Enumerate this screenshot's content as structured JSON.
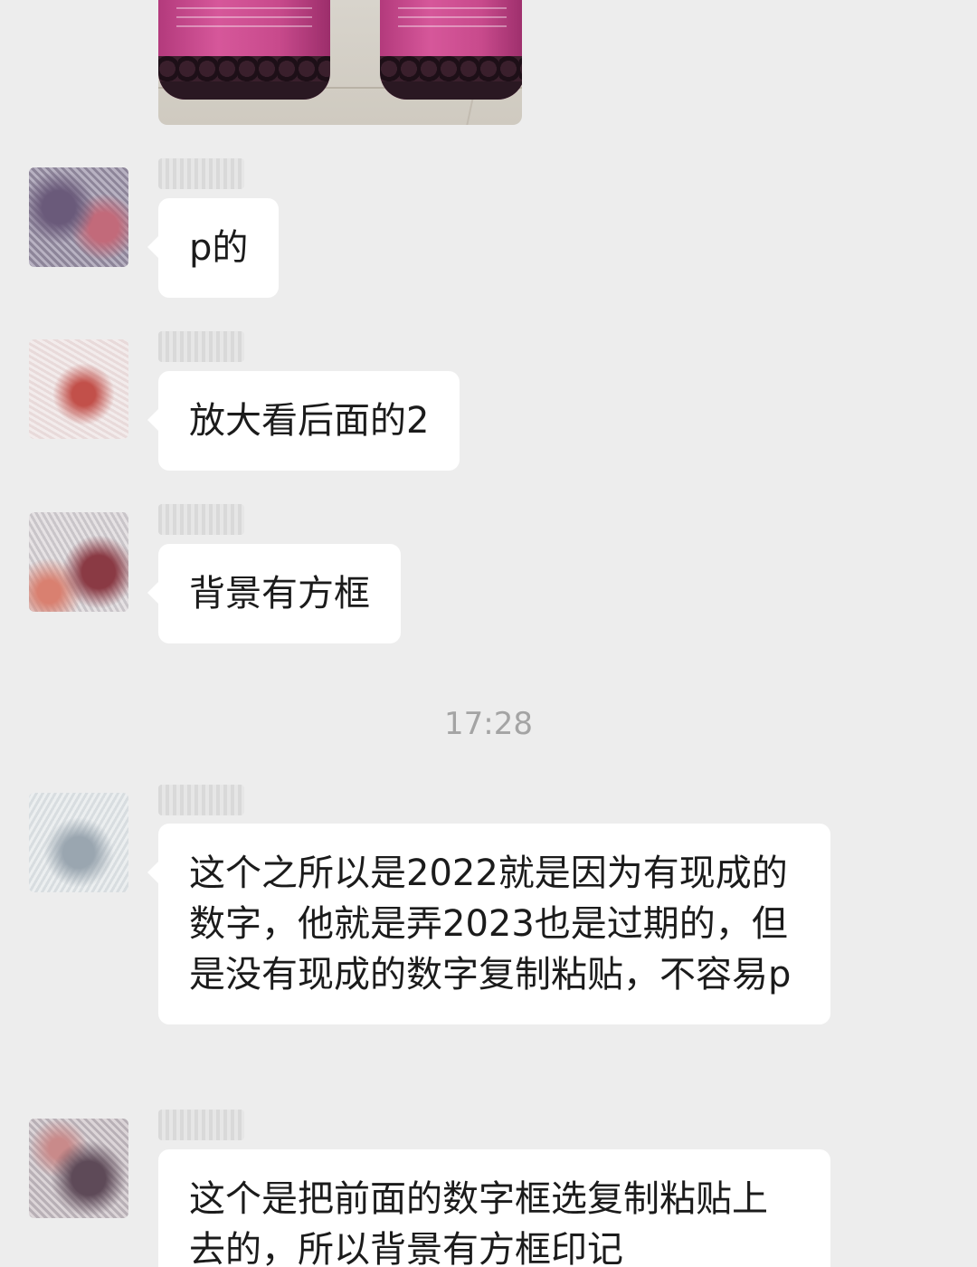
{
  "conversation": {
    "image_message": {
      "description": "photo"
    },
    "messages": [
      {
        "text": "p的"
      },
      {
        "text": "放大看后面的2"
      },
      {
        "text": "背景有方框"
      }
    ],
    "timestamp": "17:28",
    "later_messages": [
      {
        "text": "这个之所以是2022就是因为有现成的数字，他就是弄2023也是过期的，但是没有现成的数字复制粘贴，不容易p"
      },
      {
        "text": "这个是把前面的数字框选复制粘贴上去的，所以背景有方框印记"
      }
    ]
  },
  "colors": {
    "background": "#ededed",
    "bubble": "#ffffff",
    "text": "#1b1b1b",
    "timestamp": "#a4a4a4"
  }
}
